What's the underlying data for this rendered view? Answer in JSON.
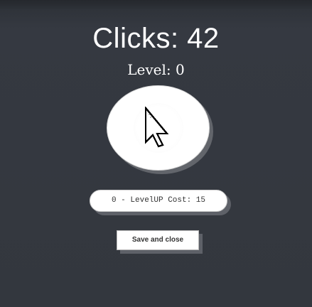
{
  "game": {
    "clicks_label": "Clicks: 42",
    "clicks": 42,
    "level_label": "Level: 0",
    "level": 0
  },
  "buttons": {
    "click_icon": "mouse-pointer-icon",
    "levelup_label": "0 - LevelUP Cost: 15",
    "save_label": "Save and close"
  },
  "colors": {
    "background": "#353941",
    "button": "#ffffff",
    "shadow": "#5e6168"
  }
}
